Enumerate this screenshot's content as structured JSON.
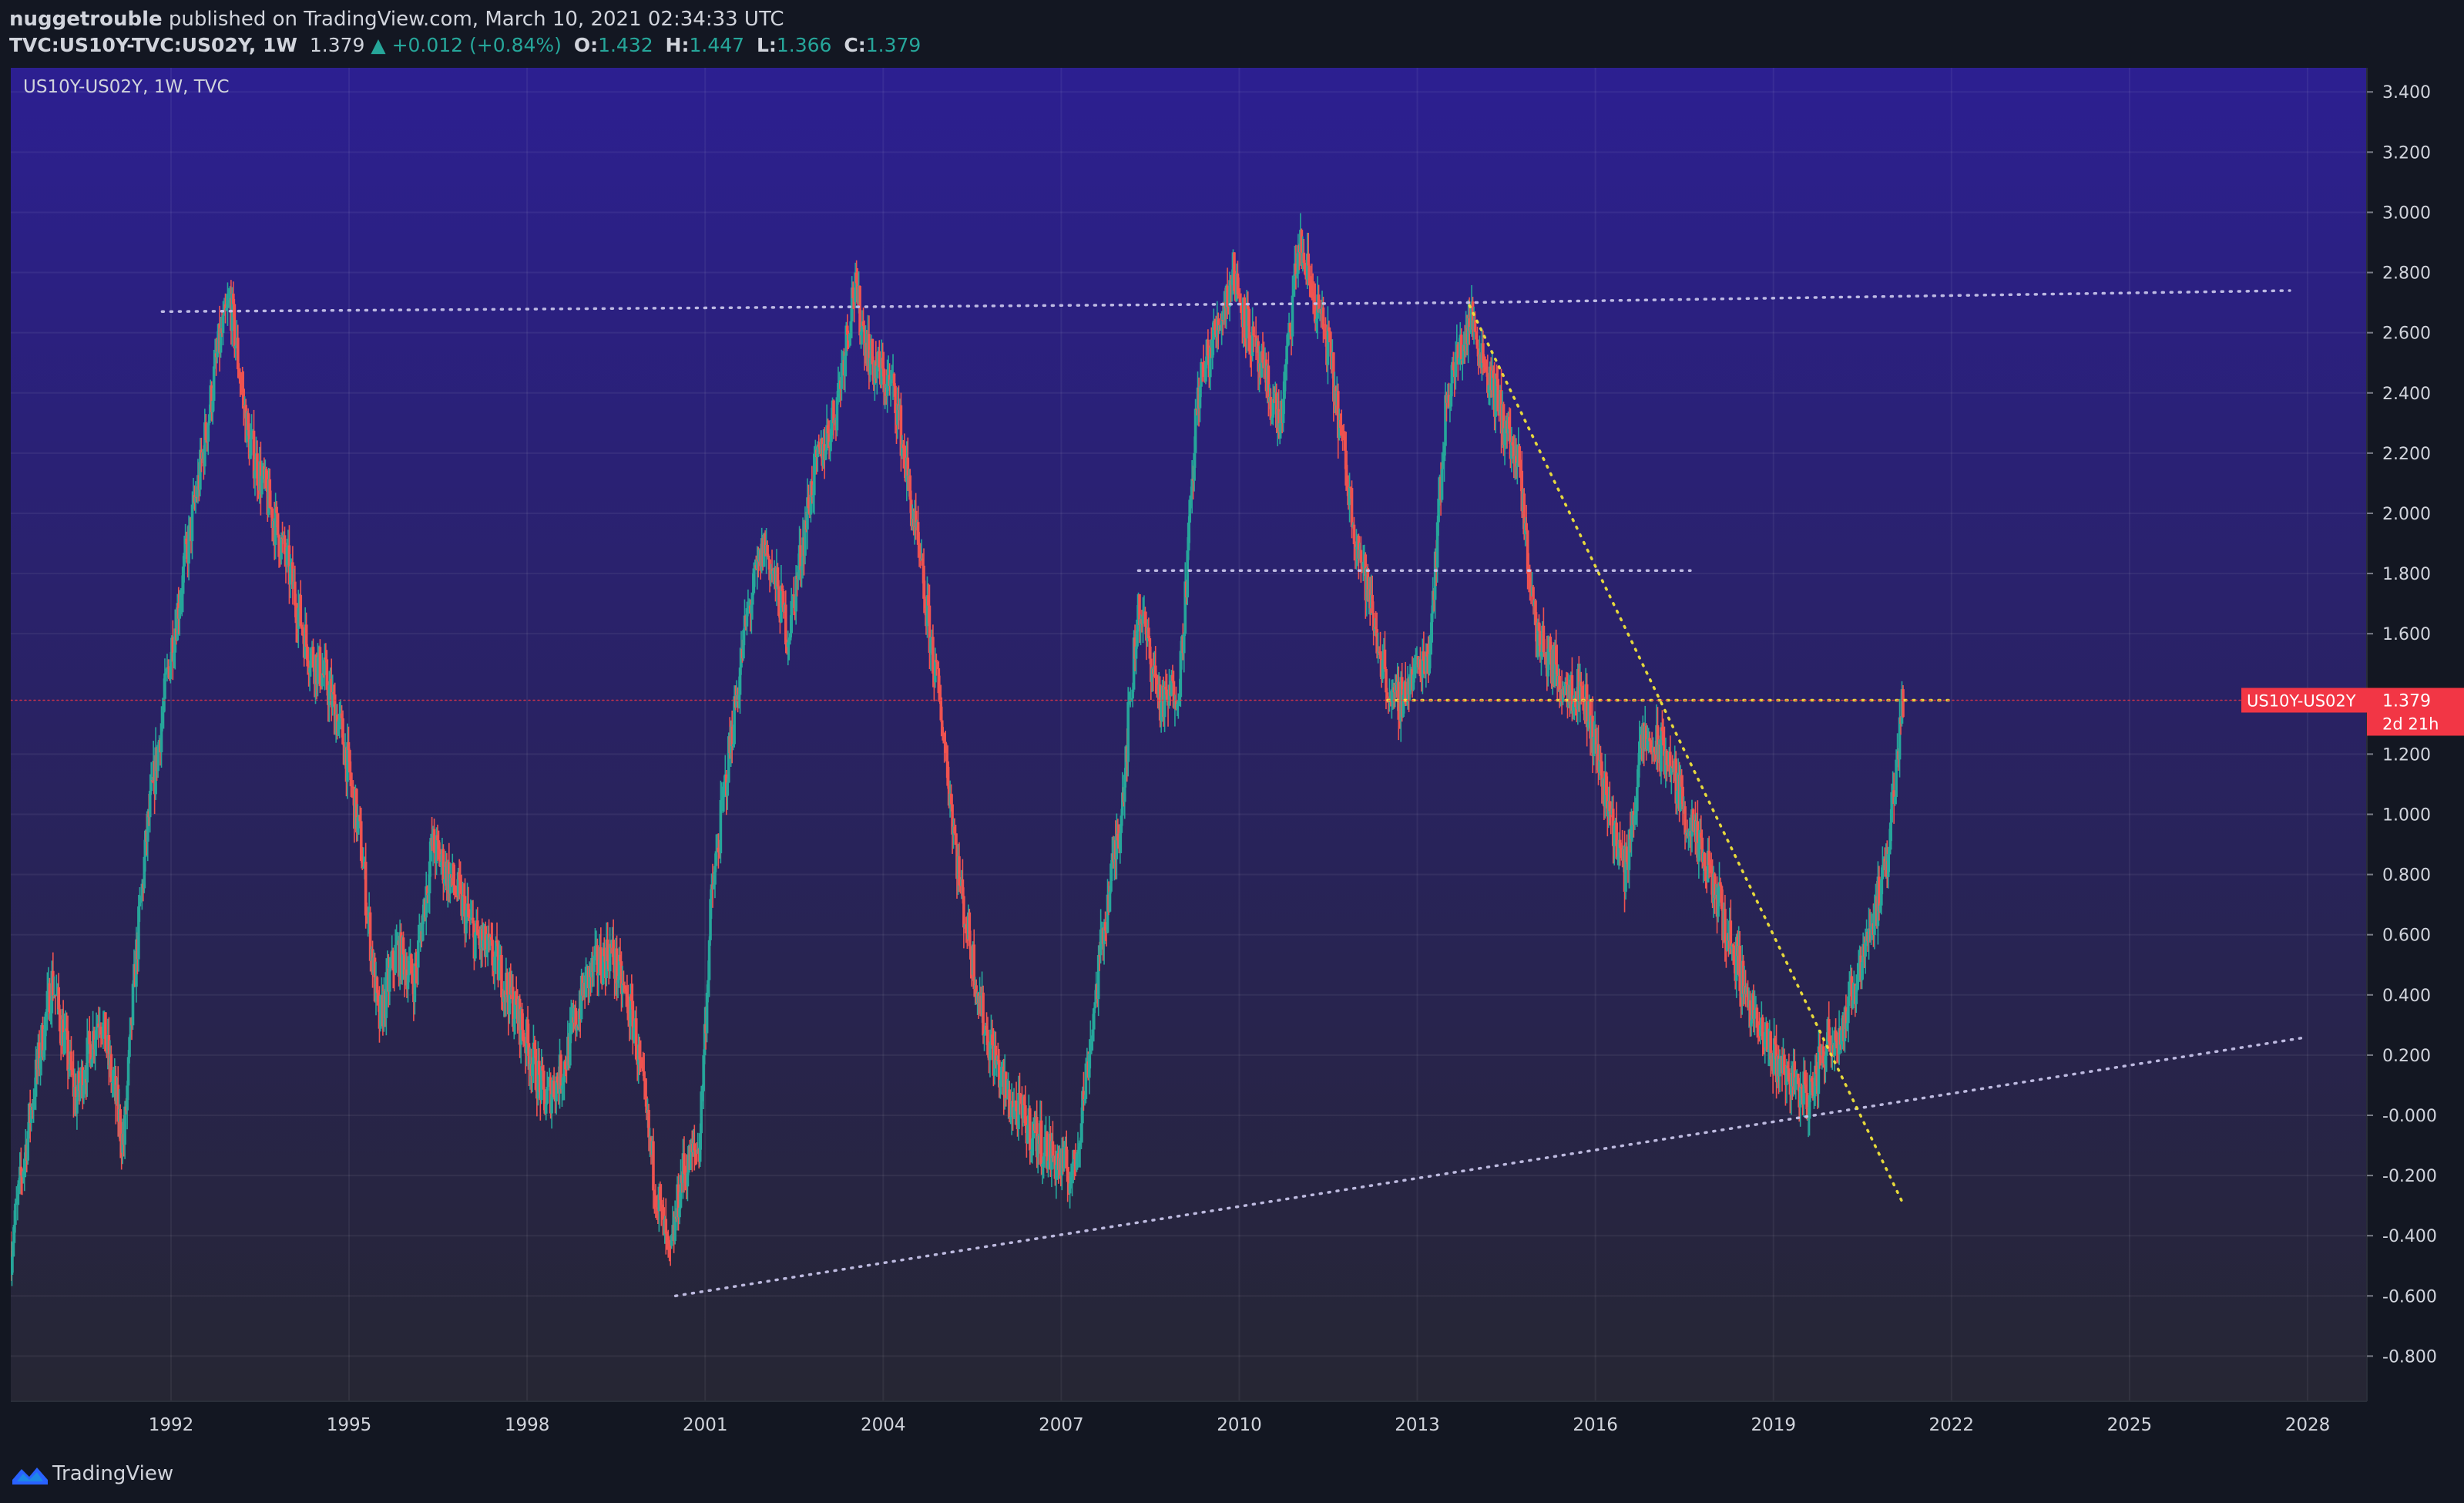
{
  "header": {
    "author": "nuggetrouble",
    "published_text": "published on TradingView.com, March 10, 2021 02:34:33 UTC",
    "symbol": "TVC:US10Y-TVC:US02Y, 1W",
    "last": "1.379",
    "change": "▲ +0.012 (+0.84%)",
    "o_label": "O:",
    "o_value": "1.432",
    "h_label": "H:",
    "h_value": "1.447",
    "l_label": "L:",
    "l_value": "1.366",
    "c_label": "C:",
    "c_value": "1.379"
  },
  "footer": {
    "brand": "TradingView",
    "logo_icon": "tradingview-logo-icon"
  },
  "colors": {
    "up": "#26a69a",
    "down": "#ef5350",
    "price_label": "#f23645",
    "trendline_white": "#c5c2e8",
    "trendline_yellow": "#f0e33a",
    "bg_top": "#2c1f91",
    "bg_bottom": "#262633"
  },
  "chart_data": {
    "type": "candlestick",
    "title": "US10Y-US02Y, 1W, TVC",
    "xlim": [
      1989.3,
      2029.0
    ],
    "ylim": [
      -0.95,
      3.48
    ],
    "x_ticks": [
      "1992",
      "1995",
      "1998",
      "2001",
      "2004",
      "2007",
      "2010",
      "2013",
      "2016",
      "2019",
      "2022",
      "2025",
      "2028"
    ],
    "x_tick_values": [
      1992,
      1995,
      1998,
      2001,
      2004,
      2007,
      2010,
      2013,
      2016,
      2019,
      2022,
      2025,
      2028
    ],
    "y_ticks": [
      "3.400",
      "3.200",
      "3.000",
      "2.800",
      "2.600",
      "2.400",
      "2.200",
      "2.000",
      "1.800",
      "1.600",
      "1.379",
      "1.200",
      "1.000",
      "0.800",
      "0.600",
      "0.400",
      "0.200",
      "-0.000",
      "-0.200",
      "-0.400",
      "-0.600",
      "-0.800"
    ],
    "y_tick_values": [
      3.4,
      3.2,
      3.0,
      2.8,
      2.6,
      2.4,
      2.2,
      2.0,
      1.8,
      1.6,
      1.379,
      1.2,
      1.0,
      0.8,
      0.6,
      0.4,
      0.2,
      0.0,
      -0.2,
      -0.4,
      -0.6,
      -0.8
    ],
    "price_label": {
      "name": "US10Y-US02Y",
      "value": "1.379",
      "countdown": "2d 21h",
      "y": 1.379
    },
    "series_path": [
      [
        1989.3,
        -0.45
      ],
      [
        1989.7,
        0.1
      ],
      [
        1990.0,
        0.45
      ],
      [
        1990.4,
        0.05
      ],
      [
        1990.8,
        0.35
      ],
      [
        1991.2,
        -0.1
      ],
      [
        1991.4,
        0.5
      ],
      [
        1991.6,
        0.95
      ],
      [
        1992.0,
        1.55
      ],
      [
        1992.5,
        2.15
      ],
      [
        1992.8,
        2.55
      ],
      [
        1993.0,
        2.7
      ],
      [
        1993.3,
        2.25
      ],
      [
        1993.7,
        2.0
      ],
      [
        1994.0,
        1.8
      ],
      [
        1994.3,
        1.55
      ],
      [
        1994.6,
        1.45
      ],
      [
        1994.9,
        1.25
      ],
      [
        1995.2,
        0.9
      ],
      [
        1995.5,
        0.3
      ],
      [
        1995.8,
        0.55
      ],
      [
        1996.1,
        0.45
      ],
      [
        1996.4,
        0.9
      ],
      [
        1996.8,
        0.75
      ],
      [
        1997.1,
        0.6
      ],
      [
        1997.5,
        0.5
      ],
      [
        1997.9,
        0.3
      ],
      [
        1998.3,
        0.05
      ],
      [
        1998.6,
        0.15
      ],
      [
        1999.0,
        0.45
      ],
      [
        1999.4,
        0.55
      ],
      [
        1999.8,
        0.3
      ],
      [
        2000.1,
        -0.15
      ],
      [
        2000.4,
        -0.5
      ],
      [
        2000.6,
        -0.2
      ],
      [
        2000.9,
        -0.1
      ],
      [
        2001.1,
        0.7
      ],
      [
        2001.4,
        1.2
      ],
      [
        2001.7,
        1.65
      ],
      [
        2002.0,
        1.9
      ],
      [
        2002.4,
        1.6
      ],
      [
        2002.8,
        2.1
      ],
      [
        2003.2,
        2.35
      ],
      [
        2003.5,
        2.75
      ],
      [
        2003.8,
        2.5
      ],
      [
        2004.2,
        2.4
      ],
      [
        2004.6,
        1.85
      ],
      [
        2005.0,
        1.3
      ],
      [
        2005.3,
        0.75
      ],
      [
        2005.7,
        0.3
      ],
      [
        2006.1,
        0.05
      ],
      [
        2006.5,
        -0.05
      ],
      [
        2006.9,
        -0.15
      ],
      [
        2007.2,
        -0.2
      ],
      [
        2007.4,
        0.1
      ],
      [
        2007.7,
        0.6
      ],
      [
        2008.0,
        1.0
      ],
      [
        2008.3,
        1.7
      ],
      [
        2008.7,
        1.35
      ],
      [
        2009.0,
        1.45
      ],
      [
        2009.3,
        2.4
      ],
      [
        2009.6,
        2.6
      ],
      [
        2009.9,
        2.8
      ],
      [
        2010.3,
        2.5
      ],
      [
        2010.7,
        2.3
      ],
      [
        2011.0,
        2.9
      ],
      [
        2011.5,
        2.55
      ],
      [
        2011.9,
        2.0
      ],
      [
        2012.3,
        1.6
      ],
      [
        2012.6,
        1.35
      ],
      [
        2012.9,
        1.45
      ],
      [
        2013.2,
        1.55
      ],
      [
        2013.5,
        2.4
      ],
      [
        2013.9,
        2.65
      ],
      [
        2014.3,
        2.4
      ],
      [
        2014.7,
        2.15
      ],
      [
        2015.0,
        1.6
      ],
      [
        2015.4,
        1.45
      ],
      [
        2015.8,
        1.4
      ],
      [
        2016.2,
        1.05
      ],
      [
        2016.5,
        0.8
      ],
      [
        2016.8,
        1.25
      ],
      [
        2017.2,
        1.2
      ],
      [
        2017.6,
        0.95
      ],
      [
        2018.0,
        0.75
      ],
      [
        2018.4,
        0.5
      ],
      [
        2018.8,
        0.25
      ],
      [
        2019.2,
        0.15
      ],
      [
        2019.6,
        0.05
      ],
      [
        2019.9,
        0.25
      ],
      [
        2020.2,
        0.3
      ],
      [
        2020.5,
        0.55
      ],
      [
        2020.9,
        0.8
      ],
      [
        2021.1,
        1.25
      ],
      [
        2021.19,
        1.379
      ]
    ],
    "trendlines": [
      {
        "style": "dotted",
        "color": "white",
        "points": [
          [
            1991.85,
            2.67
          ],
          [
            2013.88,
            2.7
          ],
          [
            2027.7,
            2.74
          ]
        ]
      },
      {
        "style": "dotted",
        "color": "white",
        "points": [
          [
            2000.5,
            -0.6
          ],
          [
            2028.0,
            0.26
          ]
        ]
      },
      {
        "style": "dotted",
        "color": "white",
        "points": [
          [
            2008.3,
            1.81
          ],
          [
            2017.6,
            1.81
          ]
        ]
      },
      {
        "style": "dotted",
        "color": "yellow",
        "points": [
          [
            2013.88,
            2.69
          ],
          [
            2021.2,
            -0.3
          ]
        ]
      },
      {
        "style": "dotted",
        "color": "yellow",
        "points": [
          [
            2012.5,
            1.379
          ],
          [
            2022.0,
            1.379
          ]
        ]
      },
      {
        "style": "dotted",
        "color": "red",
        "points": [
          [
            1989.3,
            1.379
          ],
          [
            2029.0,
            1.379
          ]
        ]
      }
    ]
  }
}
